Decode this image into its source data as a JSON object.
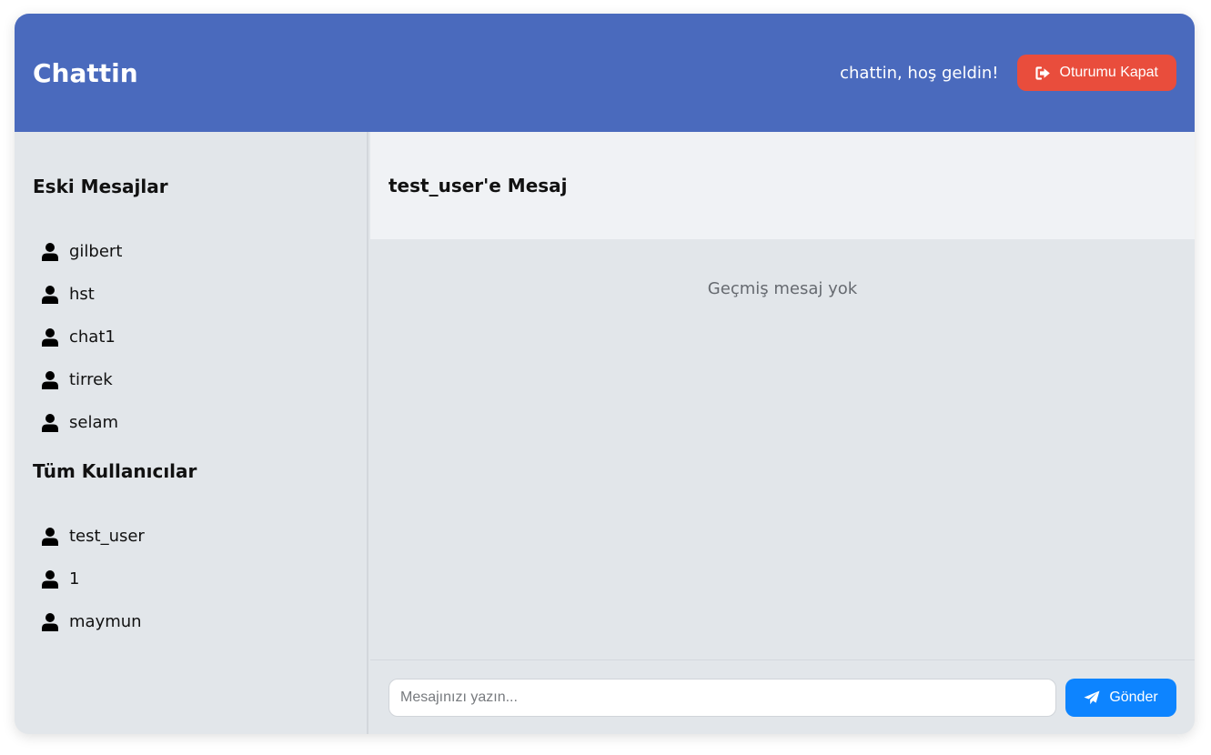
{
  "header": {
    "brand": "Chattin",
    "welcome": "chattin, hoş geldin!",
    "logout_label": "Oturumu Kapat",
    "logout_icon": "sign-out-icon"
  },
  "sidebar": {
    "old_messages_title": "Eski Mesajlar",
    "old_messages": [
      {
        "name": "gilbert",
        "icon": "user-icon"
      },
      {
        "name": "hst",
        "icon": "user-icon"
      },
      {
        "name": "chat1",
        "icon": "user-icon"
      },
      {
        "name": "tirrek",
        "icon": "user-icon"
      },
      {
        "name": "selam",
        "icon": "user-icon"
      }
    ],
    "all_users_title": "Tüm Kullanıcılar",
    "all_users": [
      {
        "name": "test_user",
        "icon": "user-icon"
      },
      {
        "name": "1",
        "icon": "user-icon"
      },
      {
        "name": "maymun",
        "icon": "user-icon"
      }
    ]
  },
  "chat": {
    "title": "test_user'e Mesaj",
    "empty_text": "Geçmiş mesaj yok",
    "input_placeholder": "Mesajınızı yazın...",
    "input_value": "",
    "send_label": "Gönder",
    "send_icon": "paper-plane-icon"
  },
  "colors": {
    "header_bg": "#4a6abd",
    "logout_bg": "#e94d3c",
    "send_bg": "#0d84ff",
    "panel_bg": "#e2e6ea",
    "chat_header_bg": "#f0f2f5"
  }
}
